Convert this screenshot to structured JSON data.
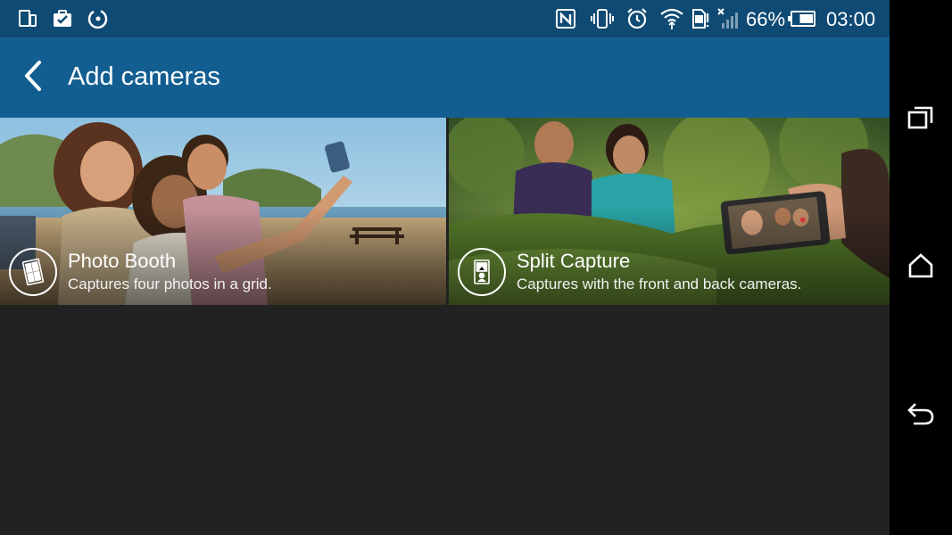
{
  "status_bar": {
    "left_icons": [
      "phone-tablet-icon",
      "clipboard-check-icon",
      "sync-circle-icon"
    ],
    "right_icons": [
      "nfc-icon",
      "vibrate-icon",
      "alarm-icon",
      "wifi-icon",
      "sim-card-icon",
      "signal-icon",
      "battery-icon"
    ],
    "battery_percent": "66%",
    "battery_level": 0.66,
    "time": "03:00"
  },
  "action_bar": {
    "back_icon": "chevron-left-icon",
    "title": "Add cameras"
  },
  "tiles": [
    {
      "title": "Photo Booth",
      "subtitle": "Captures four photos in a grid.",
      "icon": "photo-booth-icon"
    },
    {
      "title": "Split Capture",
      "subtitle": "Captures with the front and back cameras.",
      "icon": "split-capture-icon"
    }
  ],
  "nav_bar": {
    "items": [
      "recent-apps-icon",
      "home-icon",
      "back-icon"
    ]
  },
  "colors": {
    "status_bar": "#0e4a73",
    "action_bar": "#125e91",
    "background": "#222222",
    "nav_bar": "#000000"
  }
}
